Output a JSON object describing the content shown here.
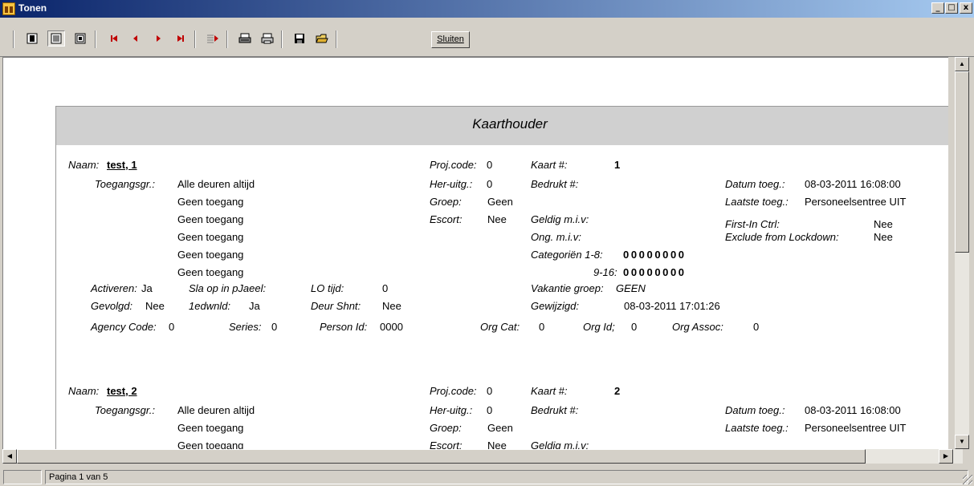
{
  "window": {
    "title": "Tonen",
    "minimize": "_",
    "maximize": "□",
    "close": "x"
  },
  "toolbar": {
    "close_label": "Sluiten"
  },
  "report": {
    "title": "Kaarthouder",
    "labels": {
      "naam": "Naam:",
      "toegang": "Toegangsgr.:",
      "activeren": "Activeren:",
      "sla": "Sla op in pJaeel:",
      "lo_tijd": "LO tijd:",
      "gevolgd": "Gevolgd:",
      "edwnld": "1edwnld:",
      "deur": "Deur Shnt:",
      "agency": "Agency Code:",
      "series": "Series:",
      "person": "Person Id:",
      "proj": "Proj.code:",
      "her": "Her-uitg.:",
      "groep": "Groep:",
      "escort": "Escort:",
      "kaart": "Kaart #:",
      "bedrukt": "Bedrukt #:",
      "geldig": "Geldig m.i.v:",
      "ong": "Ong. m.i.v:",
      "cat1": "Categoriën 1-8:",
      "cat2": "9-16:",
      "vakantie": "Vakantie groep:",
      "gewijzigd": "Gewijzigd:",
      "org_cat": "Org Cat:",
      "org_id": "Org Id;",
      "org_assoc": "Org Assoc:",
      "datum": "Datum toeg.:",
      "laatste": "Laatste toeg.:",
      "first_in": "First-In Ctrl:",
      "exclude": "Exclude from Lockdown:"
    },
    "records": [
      {
        "naam": "test, 1",
        "toegang": [
          "Alle deuren altijd",
          "Geen toegang",
          "Geen toegang",
          "Geen toegang",
          "Geen toegang",
          "Geen toegang"
        ],
        "activeren": "Ja",
        "sla": "",
        "lo_tijd": "0",
        "gevolgd": "Nee",
        "edwnld": "Ja",
        "deur": "Nee",
        "agency": "0",
        "series": "0",
        "person": "0000",
        "proj": "0",
        "her": "0",
        "groep": "Geen",
        "escort": "Nee",
        "kaart": "1",
        "cat1": "00000000",
        "cat2": "00000000",
        "vakantie": "GEEN",
        "gewijzigd": "08-03-2011 17:01:26",
        "org_cat": "0",
        "org_id": "0",
        "org_assoc": "0",
        "datum": "08-03-2011 16:08:00",
        "laatste": "Personeelsentree UIT",
        "first_in": "Nee",
        "exclude": "Nee"
      },
      {
        "naam": "test, 2",
        "toegang": [
          "Alle deuren altijd",
          "Geen toegang",
          "Geen toegang"
        ],
        "proj": "0",
        "her": "0",
        "groep": "Geen",
        "escort": "Nee",
        "kaart": "2",
        "datum": "08-03-2011 16:08:00",
        "laatste": "Personeelsentree UIT"
      }
    ]
  },
  "status": {
    "page": "Pagina 1 van 5"
  }
}
